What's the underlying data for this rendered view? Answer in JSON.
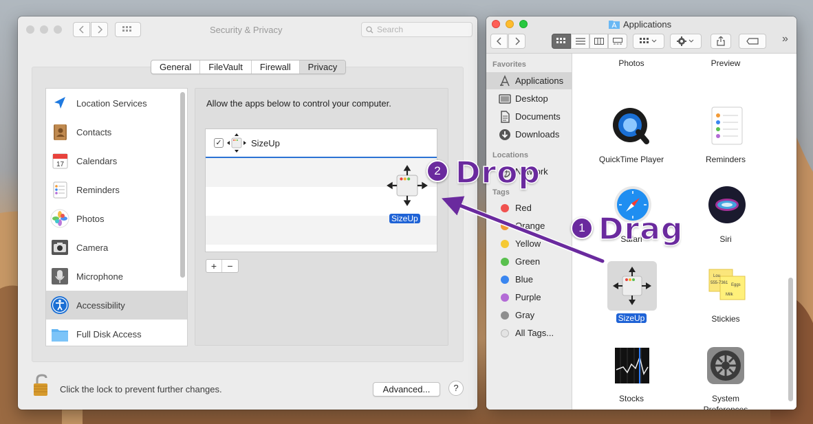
{
  "colors": {
    "accent": "#2a72d4",
    "selection_label": "#1f63d6",
    "annotation_purple": "#6a2a9e"
  },
  "security_privacy": {
    "window_title": "Security & Privacy",
    "search_placeholder": "Search",
    "tabs": [
      "General",
      "FileVault",
      "Firewall",
      "Privacy"
    ],
    "selected_tab": "Privacy",
    "sidebar_items": [
      {
        "label": "Location Services",
        "icon": "location-arrow-icon"
      },
      {
        "label": "Contacts",
        "icon": "contacts-book-icon"
      },
      {
        "label": "Calendars",
        "icon": "calendar-icon"
      },
      {
        "label": "Reminders",
        "icon": "reminders-list-icon"
      },
      {
        "label": "Photos",
        "icon": "photos-flower-icon"
      },
      {
        "label": "Camera",
        "icon": "camera-icon"
      },
      {
        "label": "Microphone",
        "icon": "microphone-icon"
      },
      {
        "label": "Accessibility",
        "icon": "accessibility-person-icon"
      },
      {
        "label": "Full Disk Access",
        "icon": "folder-icon"
      }
    ],
    "selected_item": "Accessibility",
    "description": "Allow the apps below to control your computer.",
    "apps": [
      {
        "name": "SizeUp",
        "checked": true,
        "check_glyph": "✓"
      }
    ],
    "add_label": "+",
    "remove_label": "−",
    "lock_text": "Click the lock to prevent further changes.",
    "advanced_label": "Advanced...",
    "help_label": "?"
  },
  "finder": {
    "window_title": "Applications",
    "more_label": "»",
    "sidebar": {
      "favorites_header": "Favorites",
      "favorites": [
        {
          "label": "Applications",
          "icon": "applications-icon"
        },
        {
          "label": "Desktop",
          "icon": "desktop-icon"
        },
        {
          "label": "Documents",
          "icon": "documents-icon"
        },
        {
          "label": "Downloads",
          "icon": "downloads-icon"
        }
      ],
      "locations_header": "Locations",
      "locations": [
        {
          "label": "Network",
          "icon": "network-globe-icon"
        }
      ],
      "tags_header": "Tags",
      "tags": [
        {
          "label": "Red",
          "color": "#f0524f"
        },
        {
          "label": "Orange",
          "color": "#f29b38"
        },
        {
          "label": "Yellow",
          "color": "#f5c933"
        },
        {
          "label": "Green",
          "color": "#59c04e"
        },
        {
          "label": "Blue",
          "color": "#3a86f0"
        },
        {
          "label": "Purple",
          "color": "#b36bd6"
        },
        {
          "label": "Gray",
          "color": "#8e8e8e"
        },
        {
          "label": "All Tags...",
          "color": "#e3e3e3"
        }
      ]
    },
    "grid_items": [
      "Photos",
      "Preview",
      "QuickTime Player",
      "Reminders",
      "Safari",
      "Siri",
      "SizeUp",
      "Stickies",
      "Stocks",
      "System\nPreferences"
    ],
    "selected_item": "SizeUp",
    "stickies_notes": [
      "Lou",
      "555-7361",
      "Eggs",
      "Milk"
    ]
  },
  "annotations": {
    "step1_number": "1",
    "step1_word": "Drag",
    "step2_number": "2",
    "step2_word": "Drop",
    "ghost_label": "SizeUp"
  }
}
